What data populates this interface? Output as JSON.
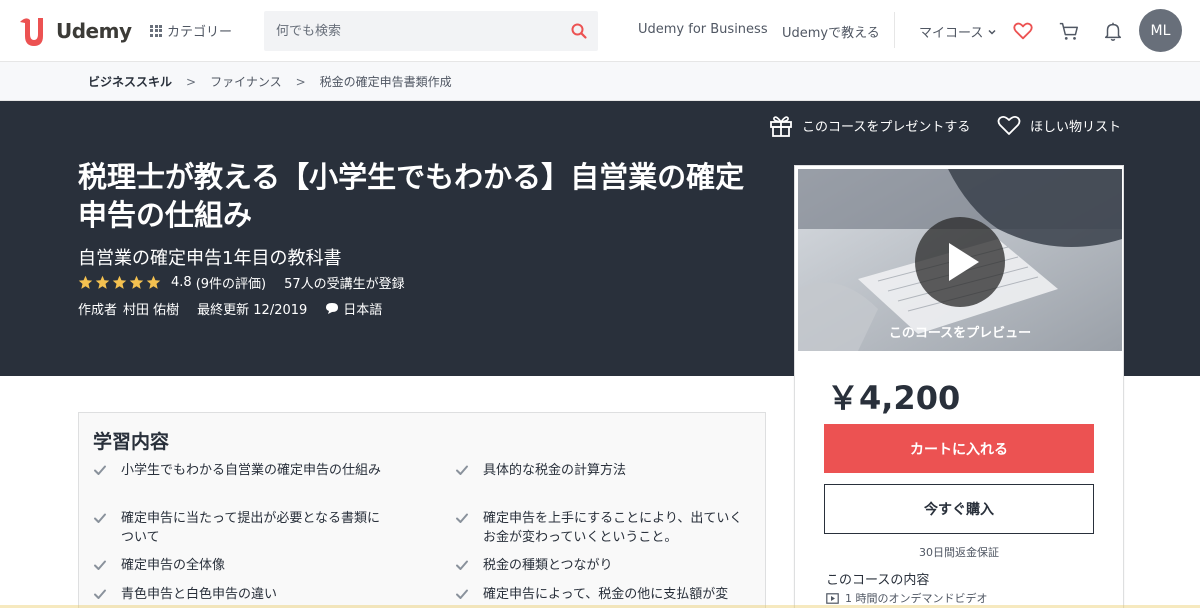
{
  "header": {
    "logo_text": "Udemy",
    "categories_label": "カテゴリー",
    "search_placeholder": "何でも検索",
    "business_link": "Udemy for Business",
    "teach_link": "Udemyで教える",
    "my_courses_label": "マイコース",
    "avatar_initials": "ML",
    "brand_color": "#ec5252"
  },
  "breadcrumb": {
    "items": [
      "ビジネススキル",
      "ファイナンス",
      "税金の確定申告書類作成"
    ],
    "separator": ">"
  },
  "hero": {
    "gift_label": "このコースをプレゼントする",
    "wishlist_label": "ほしい物リスト",
    "title": "税理士が教える【小学生でもわかる】自営業の確定申告の仕組み",
    "subtitle": "自営業の確定申告1年目の教科書",
    "stars": 5,
    "rating": "4.8",
    "rating_count": "(9件の評価)",
    "students": "57人の受講生が登録",
    "author_prefix": "作成者",
    "author": "村田 佑樹",
    "updated": "最終更新 12/2019",
    "language": "日本語",
    "star_color": "#f4c150"
  },
  "card": {
    "preview_label": "このコースをプレビュー",
    "price": "￥4,200",
    "cart_button": "カートに入れる",
    "buy_button": "今すぐ購入",
    "guarantee": "30日間返金保証",
    "includes_title": "このコースの内容",
    "includes_items": [
      "1 時間のオンデマンドビデオ"
    ]
  },
  "learn": {
    "title": "学習内容",
    "items": [
      "小学生でもわかる自営業の確定申告の仕組み",
      "具体的な税金の計算方法",
      "確定申告に当たって提出が必要となる書類について",
      "確定申告を上手にすることにより、出ていくお金が変わっていくということ。",
      "確定申告の全体像",
      "税金の種類とつながり",
      "青色申告と白色申告の違い",
      "確定申告によって、税金の他に支払額が変"
    ]
  }
}
